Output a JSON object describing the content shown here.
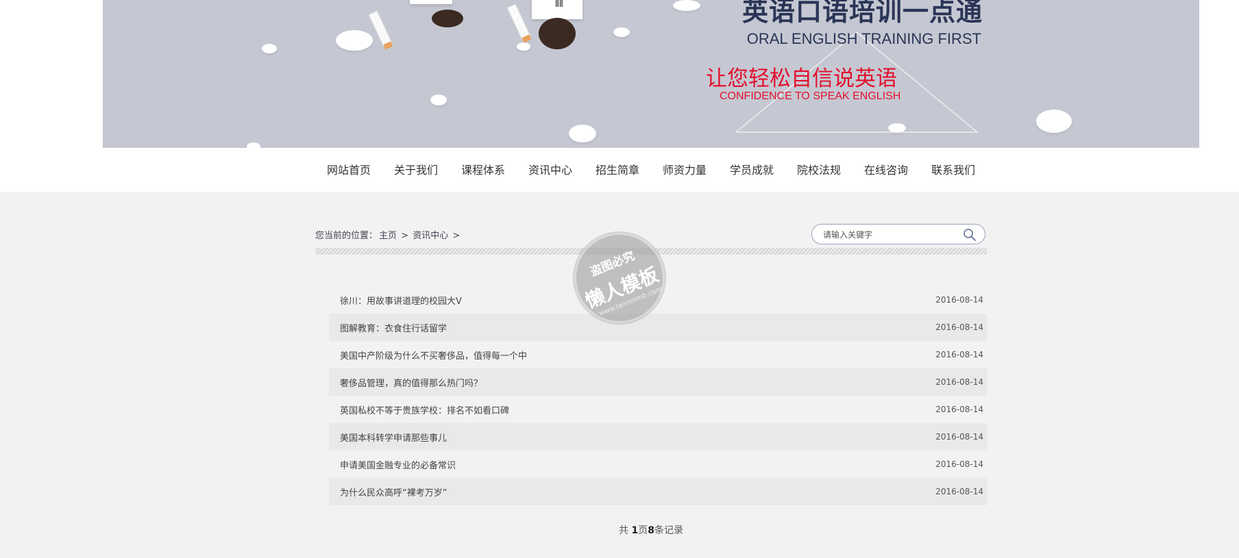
{
  "banner": {
    "title_cn": "英语口语培训一点通",
    "title_en": "ORAL ENGLISH TRAINING FIRST",
    "subtitle_cn": "让您轻松自信说英语",
    "subtitle_en": "CONFIDENCE TO SPEAK ENGLISH"
  },
  "nav": {
    "items": [
      "网站首页",
      "关于我们",
      "课程体系",
      "资讯中心",
      "招生简章",
      "师资力量",
      "学员成就",
      "院校法规",
      "在线咨询",
      "联系我们"
    ]
  },
  "breadcrumb": {
    "prefix": "您当前的位置：",
    "home": "主页",
    "sep1": ">",
    "section": "资讯中心",
    "sep2": ">"
  },
  "search": {
    "placeholder": "请输入关键字",
    "icon": "search-icon"
  },
  "articles": [
    {
      "title": "徐川：用故事讲道理的校园大V",
      "date": "2016-08-14"
    },
    {
      "title": "图解教育：衣食住行话留学",
      "date": "2016-08-14"
    },
    {
      "title": "美国中产阶级为什么不买奢侈品，值得每一个中",
      "date": "2016-08-14"
    },
    {
      "title": "奢侈品管理，真的值得那么热门吗？",
      "date": "2016-08-14"
    },
    {
      "title": "英国私校不等于贵族学校：排名不如看口碑",
      "date": "2016-08-14"
    },
    {
      "title": "美国本科转学申请那些事儿",
      "date": "2016-08-14"
    },
    {
      "title": "申请美国金融专业的必备常识",
      "date": "2016-08-14"
    },
    {
      "title": "为什么民众高呼“裸考万岁”",
      "date": "2016-08-14"
    }
  ],
  "pager": {
    "prefix": "共 ",
    "pages": "1",
    "mid": "页",
    "records": "8",
    "suffix": "条记录"
  },
  "watermark": {
    "line1": "盗图必究",
    "line2": "懒人模板",
    "line3": "www.lanrenmb.com"
  },
  "colors": {
    "banner_bg": "#c5c8d2",
    "title": "#2a3556",
    "accent_red": "#e3102e",
    "page_bg": "#f2f2f2"
  }
}
